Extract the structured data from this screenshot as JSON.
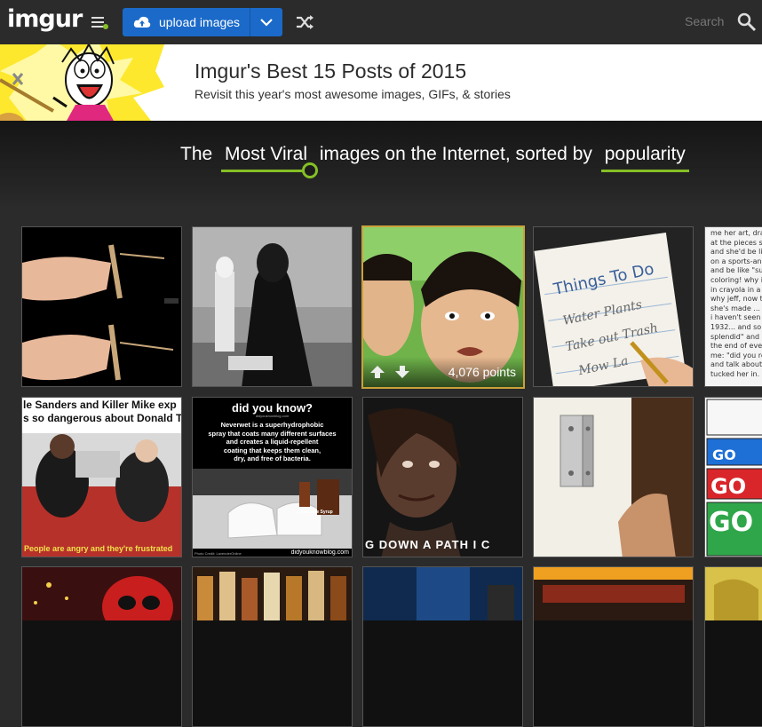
{
  "topbar": {
    "logo": "imgur",
    "upload_label": "upload images",
    "search_label": "Search"
  },
  "banner": {
    "title": "Imgur's Best 15 Posts of 2015",
    "subtitle": "Revisit this year's most awesome images, GIFs, & stories"
  },
  "hero": {
    "prefix": "The",
    "sort_section": "Most Viral",
    "middle": "images on the Internet, sorted by",
    "sort_order": "popularity"
  },
  "gallery": {
    "tiles": [
      {
        "row": 1,
        "col": 1,
        "subject": "hands knot"
      },
      {
        "row": 1,
        "col": 2,
        "subject": "darth vader"
      },
      {
        "row": 1,
        "col": 3,
        "subject": "boys faces",
        "points": "4,076 points"
      },
      {
        "row": 1,
        "col": 4,
        "subject": "things to do note",
        "note_lines": [
          "Things To Do",
          "Water Plants",
          "Take out Trash",
          "Mow La"
        ]
      },
      {
        "row": 1,
        "col": 5,
        "subject": "text story",
        "text_lines": [
          "me her art, drag",
          "at the pieces sl",
          "and she'd be li",
          "on a sports-and",
          "and be like \"suc",
          "coloring! why i",
          "in crayola in a f",
          "why jeff, now th",
          "she's made ... a",
          "i haven't seen t",
          "1932... and so",
          "splendid\" and",
          "the end of ever",
          "me: \"did you re",
          "and talk about",
          "tucked her in."
        ]
      },
      {
        "row": 2,
        "col": 1,
        "subject": "sanders and killer mike",
        "top_text": [
          "le Sanders and Killer Mike exp",
          "s so dangerous about Donald T"
        ],
        "bottom_text": "People are angry and they're frustrated"
      },
      {
        "row": 2,
        "col": 2,
        "subject": "did you know",
        "heading": "did you know?",
        "site_small": "didyouknowblog.com",
        "body": [
          "Neverwet is a superhydrophobic",
          "spray that coats many different surfaces",
          "and creates a liquid-repellent",
          "coating that keeps them clean,",
          "dry, and free of bacteria."
        ],
        "label": "Chocolate Syrup",
        "footer_left": "Photo Credit: LavenderOnline",
        "footer_right": "didyouknowblog.com"
      },
      {
        "row": 2,
        "col": 3,
        "subject": "crying woman",
        "caption": "G DOWN A PATH I C"
      },
      {
        "row": 2,
        "col": 4,
        "subject": "door hinge"
      },
      {
        "row": 2,
        "col": 5,
        "subject": "go comic",
        "words": [
          "GO",
          "GO",
          "GO"
        ]
      },
      {
        "row": 3,
        "col": 1,
        "subject": "deadpool"
      },
      {
        "row": 3,
        "col": 2,
        "subject": "bottles"
      },
      {
        "row": 3,
        "col": 3,
        "subject": "blue room"
      },
      {
        "row": 3,
        "col": 4,
        "subject": "shelf"
      },
      {
        "row": 3,
        "col": 5,
        "subject": "yellow"
      }
    ]
  },
  "colors": {
    "accent_green": "#85bf25",
    "upload_blue": "#1b6ac9",
    "active_border": "#c9a23a"
  }
}
